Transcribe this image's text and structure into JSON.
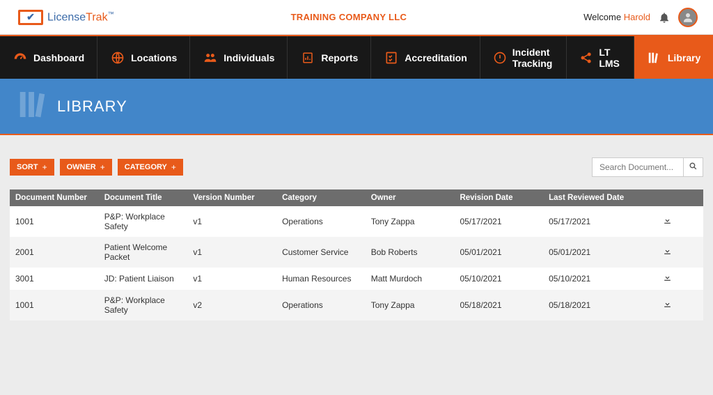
{
  "header": {
    "logo_license": "License",
    "logo_trak": "Trak",
    "company": "TRAINING COMPANY LLC",
    "welcome_prefix": "Welcome ",
    "username": "Harold"
  },
  "nav": [
    {
      "key": "dashboard",
      "label": "Dashboard"
    },
    {
      "key": "locations",
      "label": "Locations"
    },
    {
      "key": "individuals",
      "label": "Individuals"
    },
    {
      "key": "reports",
      "label": "Reports"
    },
    {
      "key": "accreditation",
      "label": "Accreditation"
    },
    {
      "key": "incident",
      "label": "Incident Tracking"
    },
    {
      "key": "ltlms",
      "label": "LT LMS"
    },
    {
      "key": "library",
      "label": "Library",
      "active": true
    }
  ],
  "page": {
    "title": "LIBRARY"
  },
  "filters": {
    "sort": "SORT",
    "owner": "OWNER",
    "category": "CATEGORY"
  },
  "search": {
    "placeholder": "Search Document..."
  },
  "table": {
    "headers": {
      "doc_no": "Document Number",
      "title": "Document Title",
      "version": "Version Number",
      "category": "Category",
      "owner": "Owner",
      "revision": "Revision Date",
      "last_reviewed": "Last Reviewed Date"
    },
    "rows": [
      {
        "doc_no": "1001",
        "title": "P&P: Workplace Safety",
        "version": "v1",
        "category": "Operations",
        "owner": "Tony Zappa",
        "revision": "05/17/2021",
        "last_reviewed": "05/17/2021"
      },
      {
        "doc_no": "2001",
        "title": "Patient Welcome Packet",
        "version": "v1",
        "category": "Customer Service",
        "owner": "Bob Roberts",
        "revision": "05/01/2021",
        "last_reviewed": "05/01/2021"
      },
      {
        "doc_no": "3001",
        "title": "JD: Patient Liaison",
        "version": "v1",
        "category": "Human Resources",
        "owner": "Matt Murdoch",
        "revision": "05/10/2021",
        "last_reviewed": "05/10/2021"
      },
      {
        "doc_no": "1001",
        "title": "P&P: Workplace Safety",
        "version": "v2",
        "category": "Operations",
        "owner": "Tony Zappa",
        "revision": "05/18/2021",
        "last_reviewed": "05/18/2021"
      }
    ]
  }
}
